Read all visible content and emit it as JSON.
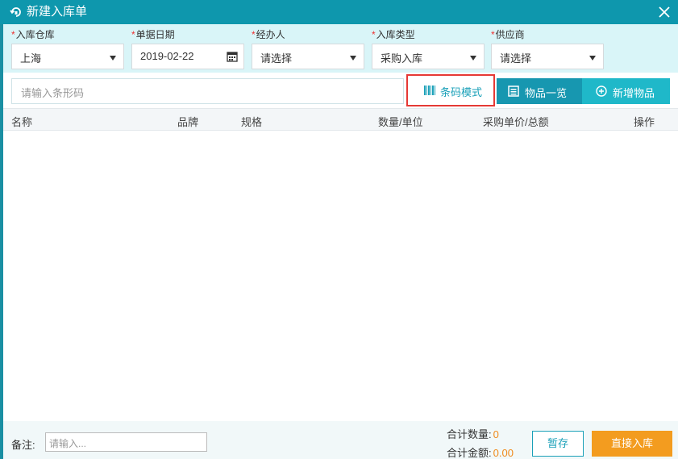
{
  "window": {
    "title": "新建入库单",
    "close_icon": "close-icon",
    "title_icon": "refresh-home-icon"
  },
  "form": {
    "warehouse": {
      "label": "入库仓库",
      "value": "上海",
      "required": true
    },
    "date": {
      "label": "单据日期",
      "value": "2019-02-22",
      "required": true
    },
    "handler": {
      "label": "经办人",
      "value": "请选择",
      "required": true
    },
    "type": {
      "label": "入库类型",
      "value": "采购入库",
      "required": true
    },
    "supplier": {
      "label": "供应商",
      "value": "请选择",
      "required": true
    }
  },
  "toolbar": {
    "barcode_placeholder": "请输入条形码",
    "barcode_mode_label": "条码模式",
    "catalog_label": "物品一览",
    "add_item_label": "新增物品"
  },
  "table": {
    "columns": [
      "名称",
      "品牌",
      "规格",
      "数量/单位",
      "采购单价/总额",
      "操作"
    ],
    "rows": []
  },
  "footer": {
    "note_label": "备注:",
    "note_placeholder": "请输入...",
    "total_qty_label": "合计数量:",
    "total_qty_value": "0",
    "total_amount_label": "合计金额:",
    "total_amount_value": "0.00",
    "save_label": "暂存",
    "stock_in_label": "直接入库"
  },
  "colors": {
    "header": "#0e97ad",
    "accent": "#1aa0b8",
    "orange": "#f39c1f",
    "highlight": "#e53935"
  }
}
